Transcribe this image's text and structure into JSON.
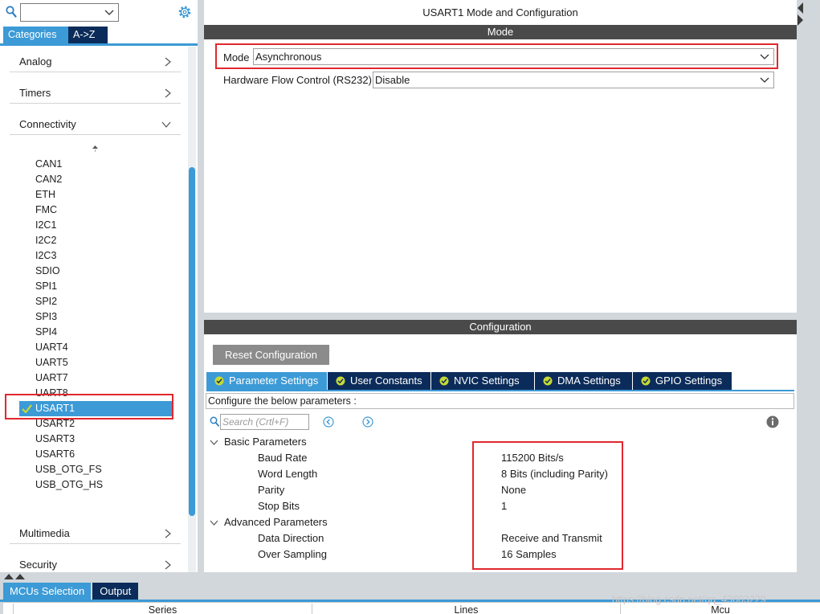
{
  "left_panel": {
    "search_value": "",
    "tabs": [
      "Categories",
      "A->Z"
    ],
    "categories": [
      {
        "label": "Analog",
        "state": "collapsed"
      },
      {
        "label": "Timers",
        "state": "collapsed"
      },
      {
        "label": "Connectivity",
        "state": "expanded"
      },
      {
        "label": "Multimedia",
        "state": "collapsed"
      },
      {
        "label": "Security",
        "state": "collapsed"
      }
    ],
    "peripherals": [
      "CAN1",
      "CAN2",
      "ETH",
      "FMC",
      "I2C1",
      "I2C2",
      "I2C3",
      "SDIO",
      "SPI1",
      "SPI2",
      "SPI3",
      "SPI4",
      "UART4",
      "UART5",
      "UART7",
      "UART8",
      "USART1",
      "USART2",
      "USART3",
      "USART6",
      "USB_OTG_FS",
      "USB_OTG_HS"
    ],
    "selected_peripheral": "USART1"
  },
  "right_panel": {
    "title": "USART1 Mode and Configuration",
    "mode_header": "Mode",
    "mode_label": "Mode",
    "mode_value": "Asynchronous",
    "flow_label": "Hardware Flow Control (RS232)",
    "flow_value": "Disable",
    "config_header": "Configuration",
    "reset_button": "Reset Configuration",
    "config_tabs": [
      "Parameter Settings",
      "User Constants",
      "NVIC Settings",
      "DMA Settings",
      "GPIO Settings"
    ],
    "active_config_tab": "Parameter Settings",
    "hint": "Configure the below parameters :",
    "search_placeholder": "Search (Crtl+F)",
    "groups": [
      {
        "name": "Basic Parameters",
        "params": [
          {
            "name": "Baud Rate",
            "value": "115200 Bits/s"
          },
          {
            "name": "Word Length",
            "value": "8 Bits (including Parity)"
          },
          {
            "name": "Parity",
            "value": "None"
          },
          {
            "name": "Stop Bits",
            "value": "1"
          }
        ]
      },
      {
        "name": "Advanced Parameters",
        "params": [
          {
            "name": "Data Direction",
            "value": "Receive and Transmit"
          },
          {
            "name": "Over Sampling",
            "value": "16 Samples"
          }
        ]
      }
    ]
  },
  "bottom_panel": {
    "tabs": [
      "MCUs Selection",
      "Output"
    ],
    "columns": [
      "Series",
      "Lines",
      "Mcu"
    ],
    "watermark": "https://blog.csdn.net/qq_43603229"
  },
  "colors": {
    "accent": "#3c9ad6",
    "dark_tab": "#0b2c5a",
    "header_bar": "#4a4a4a",
    "highlight_box": "#e0282e",
    "check": "#c7d935"
  }
}
